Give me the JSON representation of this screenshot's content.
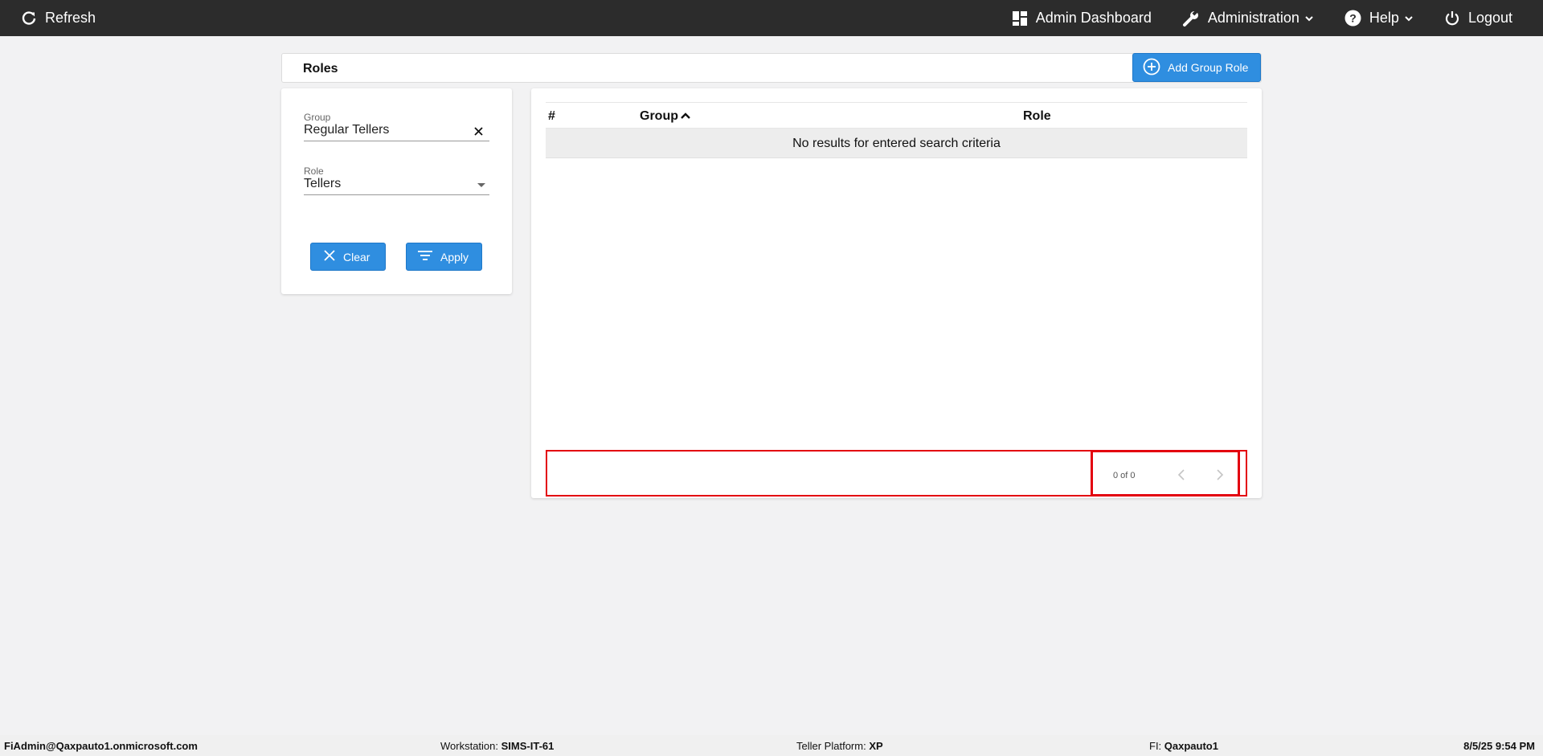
{
  "topbar": {
    "refresh_label": "Refresh",
    "admin_dashboard_label": "Admin Dashboard",
    "administration_label": "Administration",
    "help_label": "Help",
    "logout_label": "Logout"
  },
  "page": {
    "title": "Roles",
    "add_button_label": "Add Group Role"
  },
  "filters": {
    "group_label": "Group",
    "group_value": "Regular Tellers",
    "role_label": "Role",
    "role_value": "Tellers",
    "clear_label": "Clear",
    "apply_label": "Apply"
  },
  "table": {
    "columns": [
      "#",
      "Group",
      "Role"
    ],
    "empty_message": "No results for entered search criteria"
  },
  "pager": {
    "count_text": "0 of 0"
  },
  "statusbar": {
    "user": "FiAdmin@Qaxpauto1.onmicrosoft.com",
    "workstation_label": "Workstation:",
    "workstation_value": "SIMS-IT-61",
    "platform_label": "Teller Platform:",
    "platform_value": "XP",
    "fi_label": "FI:",
    "fi_value": "Qaxpauto1",
    "datetime": "8/5/25 9:54 PM"
  },
  "colors": {
    "topbar_bg": "#2c2c2c",
    "accent": "#2f8ee0",
    "highlight_border": "#e3000f"
  }
}
